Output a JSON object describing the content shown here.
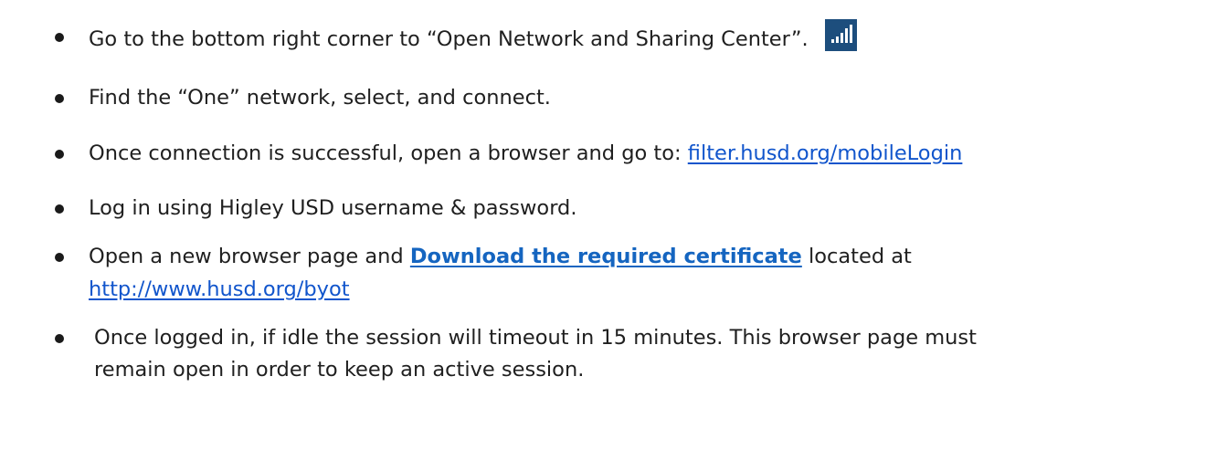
{
  "steps": [
    {
      "text": "Go to the bottom right corner to “Open Network and Sharing Center”.",
      "icon": "network-signal-icon"
    },
    {
      "text": "Find the “One” network, select, and connect."
    },
    {
      "text": "Once connection is successful, open a browser and go to: ",
      "link": "filter.husd.org/mobileLogin"
    },
    {
      "text": "Log in using Higley USD username &  password."
    },
    {
      "text_before": "Open a new browser page and ",
      "link": "Download the required certificate",
      "text_after": " located at",
      "line2_link": "http://www.husd.org/byot"
    },
    {
      "line1": "Once logged in, if idle the session will timeout in 15 minutes. This browser page must",
      "line2": "remain open in order to keep an active session."
    }
  ],
  "colors": {
    "link": "#1155cc",
    "cert_link": "#1565c0",
    "icon_tile": "#1d4e7d"
  }
}
